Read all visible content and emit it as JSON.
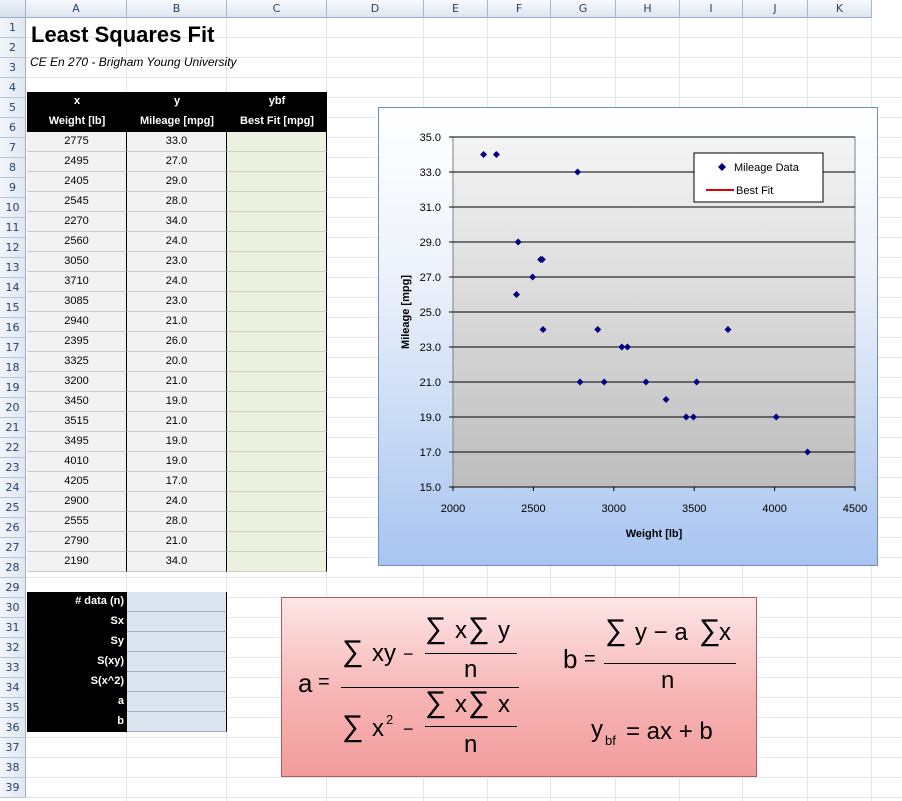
{
  "columns": [
    "A",
    "B",
    "C",
    "D",
    "E",
    "F",
    "G",
    "H",
    "I",
    "J",
    "K"
  ],
  "rows": [
    "1",
    "2",
    "3",
    "4",
    "5",
    "6",
    "7",
    "8",
    "9",
    "10",
    "11",
    "12",
    "13",
    "14",
    "15",
    "16",
    "17",
    "18",
    "19",
    "20",
    "21",
    "22",
    "23",
    "24",
    "25",
    "26",
    "27",
    "28",
    "29",
    "30",
    "31",
    "32",
    "33",
    "34",
    "35",
    "36",
    "37",
    "38",
    "39"
  ],
  "sheet": {
    "title": "Least Squares Fit",
    "subtitle": "CE En 270 - Brigham Young University",
    "headers": {
      "x_var": "x",
      "y_var": "y",
      "ybf_var": "ybf",
      "x_label": "Weight [lb]",
      "y_label": "Mileage [mpg]",
      "ybf_label": "Best Fit [mpg]"
    },
    "data": [
      {
        "x": "2775",
        "y": "33.0"
      },
      {
        "x": "2495",
        "y": "27.0"
      },
      {
        "x": "2405",
        "y": "29.0"
      },
      {
        "x": "2545",
        "y": "28.0"
      },
      {
        "x": "2270",
        "y": "34.0"
      },
      {
        "x": "2560",
        "y": "24.0"
      },
      {
        "x": "3050",
        "y": "23.0"
      },
      {
        "x": "3710",
        "y": "24.0"
      },
      {
        "x": "3085",
        "y": "23.0"
      },
      {
        "x": "2940",
        "y": "21.0"
      },
      {
        "x": "2395",
        "y": "26.0"
      },
      {
        "x": "3325",
        "y": "20.0"
      },
      {
        "x": "3200",
        "y": "21.0"
      },
      {
        "x": "3450",
        "y": "19.0"
      },
      {
        "x": "3515",
        "y": "21.0"
      },
      {
        "x": "3495",
        "y": "19.0"
      },
      {
        "x": "4010",
        "y": "19.0"
      },
      {
        "x": "4205",
        "y": "17.0"
      },
      {
        "x": "2900",
        "y": "24.0"
      },
      {
        "x": "2555",
        "y": "28.0"
      },
      {
        "x": "2790",
        "y": "21.0"
      },
      {
        "x": "2190",
        "y": "34.0"
      }
    ],
    "stats_labels": [
      "# data (n)",
      "Sx",
      "Sy",
      "S(xy)",
      "S(x^2)",
      "a",
      "b"
    ]
  },
  "chart_data": {
    "type": "scatter",
    "xlabel": "Weight [lb]",
    "ylabel": "Mileage  [mpg]",
    "xlim": [
      2000,
      4500
    ],
    "ylim": [
      15,
      35
    ],
    "xticks": [
      "2000",
      "2500",
      "3000",
      "3500",
      "4000",
      "4500"
    ],
    "yticks": [
      "35.0",
      "33.0",
      "31.0",
      "29.0",
      "27.0",
      "25.0",
      "23.0",
      "21.0",
      "19.0",
      "17.0",
      "15.0"
    ],
    "grid": "horizontal",
    "legend_position": "top-right",
    "series": [
      {
        "name": "Mileage Data",
        "color": "#000080",
        "x": [
          2775,
          2495,
          2405,
          2545,
          2270,
          2560,
          3050,
          3710,
          3085,
          2940,
          2395,
          3325,
          3200,
          3450,
          3515,
          3495,
          4010,
          4205,
          2900,
          2555,
          2790,
          2190
        ],
        "y": [
          33,
          27,
          29,
          28,
          34,
          24,
          23,
          24,
          23,
          21,
          26,
          20,
          21,
          19,
          21,
          19,
          19,
          17,
          24,
          28,
          21,
          34
        ]
      },
      {
        "name": "Best Fit",
        "color": "#e00000",
        "x": [],
        "y": []
      }
    ]
  },
  "formulas": {
    "sum": "∑",
    "a_lhs": "a",
    "eq": "=",
    "xy": "xy",
    "minus": "−",
    "x": "x",
    "y": "y",
    "n": "n",
    "x2_sup": "2",
    "b_lhs": "b",
    "y_minus_a": "y − a",
    "ybf_y": "y",
    "ybf_sub": "bf",
    "ybf_rhs": "= ax + b"
  }
}
